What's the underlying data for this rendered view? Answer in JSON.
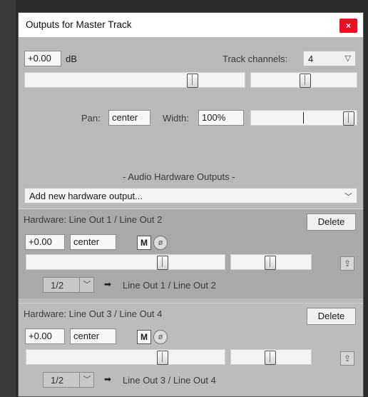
{
  "window": {
    "title": "Outputs for Master Track",
    "close_glyph": "×"
  },
  "master": {
    "volume": "+0.00",
    "volume_unit": "dB",
    "channels_label": "Track channels:",
    "channels_value": "4",
    "pan_label": "Pan:",
    "pan_value": "center",
    "width_label": "Width:",
    "width_value": "100%",
    "volume_slider_level": 0.8,
    "pan_slider_level": 0.5,
    "width_slider_level": 1.0
  },
  "section": {
    "header": "- Audio Hardware Outputs -",
    "add_output": "Add new hardware output..."
  },
  "hardware_outputs": [
    {
      "title": "Hardware: Line Out 1 / Line Out 2",
      "delete_label": "Delete",
      "volume": "+0.00",
      "pan": "center",
      "mute": "M",
      "phase": "ø",
      "channel_select": "1/2",
      "arrow": "➡",
      "destination": "Line Out 1 / Line Out 2"
    },
    {
      "title": "Hardware: Line Out 3 / Line Out 4",
      "delete_label": "Delete",
      "volume": "+0.00",
      "pan": "center",
      "mute": "M",
      "phase": "ø",
      "channel_select": "1/2",
      "arrow": "➡",
      "destination": "Line Out 3 / Line Out 4"
    }
  ],
  "icons": {
    "dropdown": "chevron-down-icon",
    "route": "route-icon",
    "phase": "phase-invert-icon",
    "arrow": "arrow-right-icon"
  }
}
